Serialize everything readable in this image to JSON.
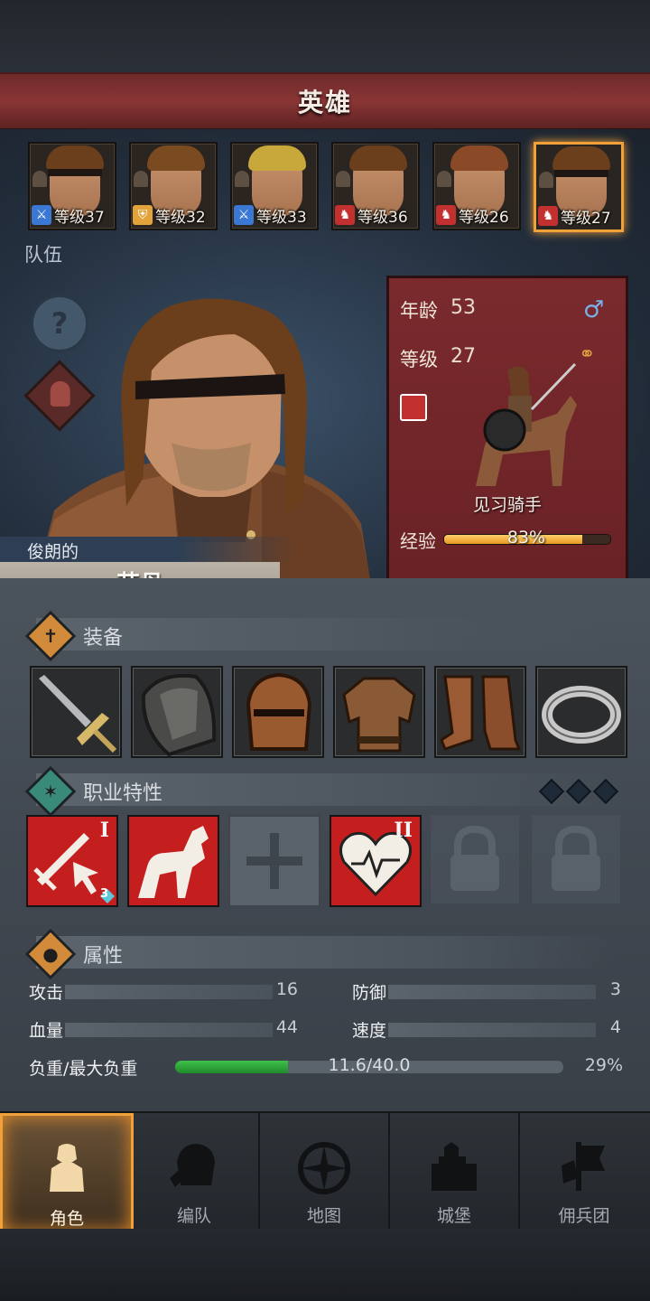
{
  "header": {
    "title": "英雄"
  },
  "heroes": [
    {
      "level": "等级37",
      "class_icon": "sword-icon",
      "class_color": "#3b78d4",
      "hair": "#6b3e1c",
      "eyepatch": true
    },
    {
      "level": "等级32",
      "class_icon": "shield-icon",
      "class_color": "#e2a33a",
      "hair": "#7a4a20",
      "eyepatch": false
    },
    {
      "level": "等级33",
      "class_icon": "sword-icon",
      "class_color": "#3b78d4",
      "hair": "#c8a83a",
      "eyepatch": false
    },
    {
      "level": "等级36",
      "class_icon": "horse-icon",
      "class_color": "#c23030",
      "hair": "#6b3e1c",
      "eyepatch": false
    },
    {
      "level": "等级26",
      "class_icon": "horse-icon",
      "class_color": "#c23030",
      "hair": "#8a4a28",
      "eyepatch": false
    },
    {
      "level": "等级27",
      "class_icon": "horse-icon",
      "class_color": "#c23030",
      "hair": "#6b3e1c",
      "eyepatch": false,
      "selected": true
    }
  ],
  "team_label": "队伍",
  "hero_detail": {
    "title": "俊朗的",
    "name": "艾丹",
    "age_label": "年龄",
    "age": "53",
    "level_label": "等级",
    "level": "27",
    "class_name": "见习骑手",
    "exp_label": "经验",
    "exp_percent": 83,
    "exp_text": "83%"
  },
  "sections": {
    "equipment": "装备",
    "traits": "职业特性",
    "attributes": "属性"
  },
  "equipment": [
    "sword-icon",
    "shield-icon",
    "helmet-icon",
    "armor-icon",
    "boots-icon",
    "ring-icon"
  ],
  "traits": [
    {
      "name": "attack-trait",
      "tier": "I",
      "badge": "3",
      "state": "red"
    },
    {
      "name": "horse-trait",
      "tier": "",
      "state": "red"
    },
    {
      "name": "empty-trait-slot",
      "tier": "",
      "state": "empty"
    },
    {
      "name": "heart-trait",
      "tier": "II",
      "state": "red"
    },
    {
      "name": "locked-trait-slot",
      "tier": "",
      "state": "locked"
    },
    {
      "name": "locked-trait-slot",
      "tier": "",
      "state": "locked"
    }
  ],
  "stats": {
    "attack_label": "攻击",
    "attack": "16",
    "defense_label": "防御",
    "defense": "3",
    "hp_label": "血量",
    "hp": "44",
    "speed_label": "速度",
    "speed": "4",
    "load_label": "负重/最大负重",
    "load_text": "11.6/40.0",
    "load_fraction": 0.29,
    "load_percent": "29%"
  },
  "nav": [
    {
      "label": "角色",
      "icon": "knight-icon",
      "active": true
    },
    {
      "label": "编队",
      "icon": "helmet-icon",
      "active": false
    },
    {
      "label": "地图",
      "icon": "compass-icon",
      "active": false
    },
    {
      "label": "城堡",
      "icon": "castle-icon",
      "active": false
    },
    {
      "label": "佣兵团",
      "icon": "banner-icon",
      "active": false
    }
  ]
}
